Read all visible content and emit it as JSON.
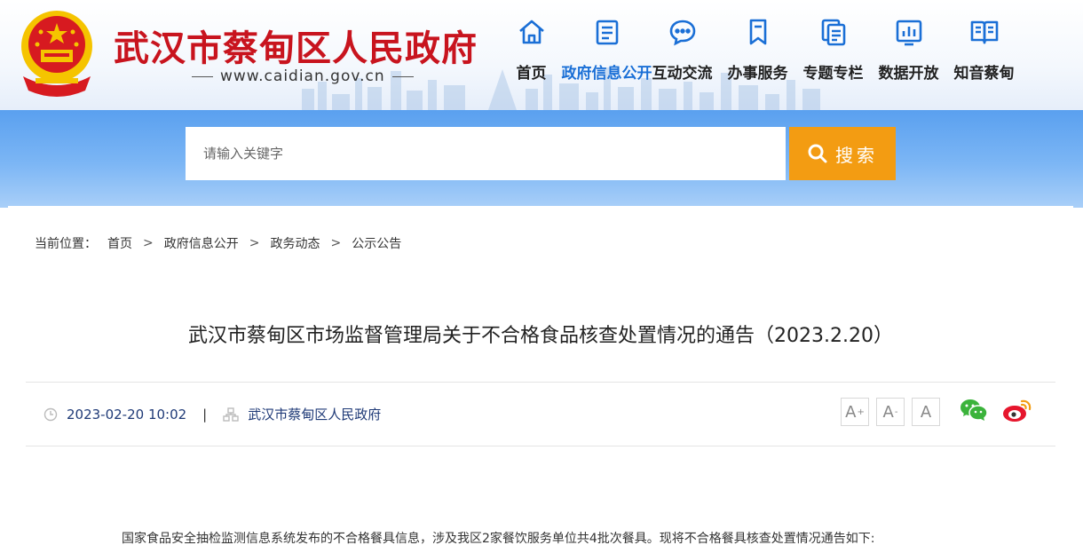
{
  "header": {
    "site_title": "武汉市蔡甸区人民政府",
    "site_url": "www.caidian.gov.cn"
  },
  "nav": [
    {
      "label": "首页",
      "icon": "home-icon",
      "active": false
    },
    {
      "label": "政府信息公开",
      "icon": "document-list-icon",
      "active": true
    },
    {
      "label": "互动交流",
      "icon": "chat-bubble-icon",
      "active": false
    },
    {
      "label": "办事服务",
      "icon": "bookmark-icon",
      "active": false
    },
    {
      "label": "专题专栏",
      "icon": "pages-icon",
      "active": false
    },
    {
      "label": "数据开放",
      "icon": "bar-chart-icon",
      "active": false
    },
    {
      "label": "知音蔡甸",
      "icon": "open-book-icon",
      "active": false
    }
  ],
  "search": {
    "placeholder": "请输入关键字",
    "button_label": "搜索"
  },
  "breadcrumb": {
    "prefix": "当前位置：",
    "items": [
      "首页",
      "政府信息公开",
      "政务动态",
      "公示公告"
    ],
    "separator": ">"
  },
  "article": {
    "title": "武汉市蔡甸区市场监督管理局关于不合格食品核查处置情况的通告（2023.2.20）",
    "date": "2023-02-20 10:02",
    "source": "武汉市蔡甸区人民政府",
    "body_first_line": "国家食品安全抽检监测信息系统发布的不合格餐具信息，涉及我区2家餐饮服务单位共4批次餐具。现将不合格餐具核查处置情况通告如下:"
  },
  "font_tools": {
    "increase": "A",
    "decrease": "A",
    "reset": "A",
    "increase_mark": "+",
    "decrease_mark": "-"
  },
  "colors": {
    "brand_red": "#c8141e",
    "nav_blue": "#1a6fd6",
    "search_orange": "#f39c12",
    "band_blue": "#5aa0ef"
  }
}
